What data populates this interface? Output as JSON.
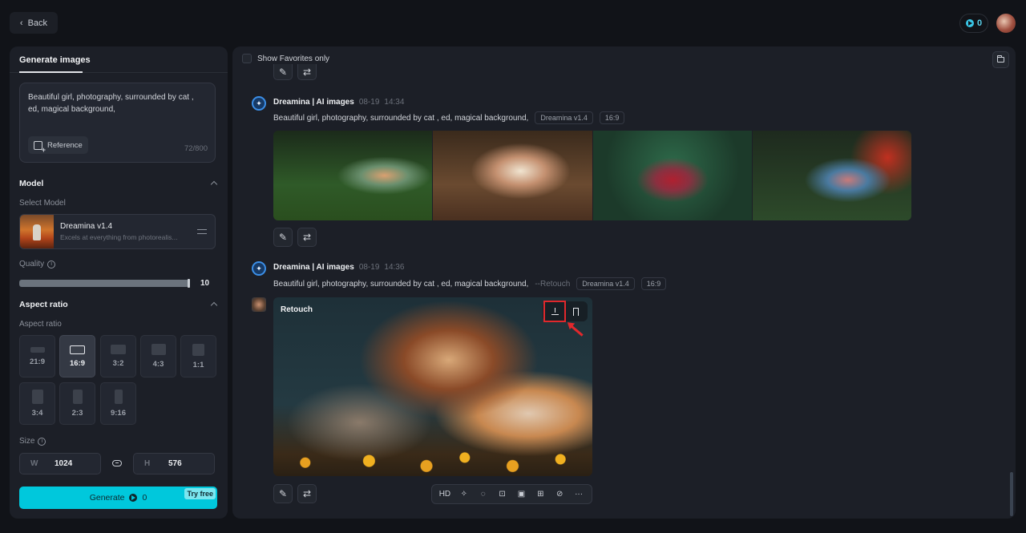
{
  "header": {
    "back_label": "Back",
    "credits": "0"
  },
  "left_panel": {
    "tab_label": "Generate images",
    "prompt_text": "Beautiful girl, photography, surrounded by cat , ed, magical background,",
    "reference_label": "Reference",
    "char_count": "72/800",
    "model_section": {
      "title": "Model",
      "select_label": "Select Model",
      "model_name": "Dreamina v1.4",
      "model_desc": "Excels at everything from photorealis..."
    },
    "quality": {
      "label": "Quality",
      "value": "10",
      "fraction": 1.0
    },
    "aspect_section": {
      "title": "Aspect ratio",
      "sub_label": "Aspect ratio",
      "options": [
        "21:9",
        "16:9",
        "3:2",
        "4:3",
        "1:1",
        "3:4",
        "2:3",
        "9:16"
      ],
      "selected": "16:9"
    },
    "size": {
      "label": "Size",
      "width_axis": "W",
      "width": "1024",
      "height_axis": "H",
      "height": "576"
    },
    "generate": {
      "label": "Generate",
      "cost": "0",
      "badge": "Try free"
    }
  },
  "right_panel": {
    "favorites_label": "Show Favorites only",
    "messages": [
      {
        "author": "Dreamina | AI images",
        "date": "08-19",
        "time": "14:34",
        "prompt": "Beautiful girl, photography, surrounded by cat , ed, magical background,",
        "model_tag": "Dreamina v1.4",
        "ratio_tag": "16:9",
        "image_count": 4
      },
      {
        "author": "Dreamina | AI images",
        "date": "08-19",
        "time": "14:36",
        "prompt": "Beautiful girl, photography, surrounded by cat , ed, magical background,",
        "retouch_tag": "--Retouch",
        "model_tag": "Dreamina v1.4",
        "ratio_tag": "16:9",
        "image_label": "Retouch"
      }
    ],
    "toolbar": {
      "hd_label": "HD",
      "more_label": "···"
    },
    "icons": {
      "edit": "✎",
      "regenerate": "⇄",
      "magic": "✧",
      "eraser": "◌",
      "expand": "⊡",
      "inpaint": "▣",
      "resize": "⊞",
      "link": "⊘"
    }
  }
}
